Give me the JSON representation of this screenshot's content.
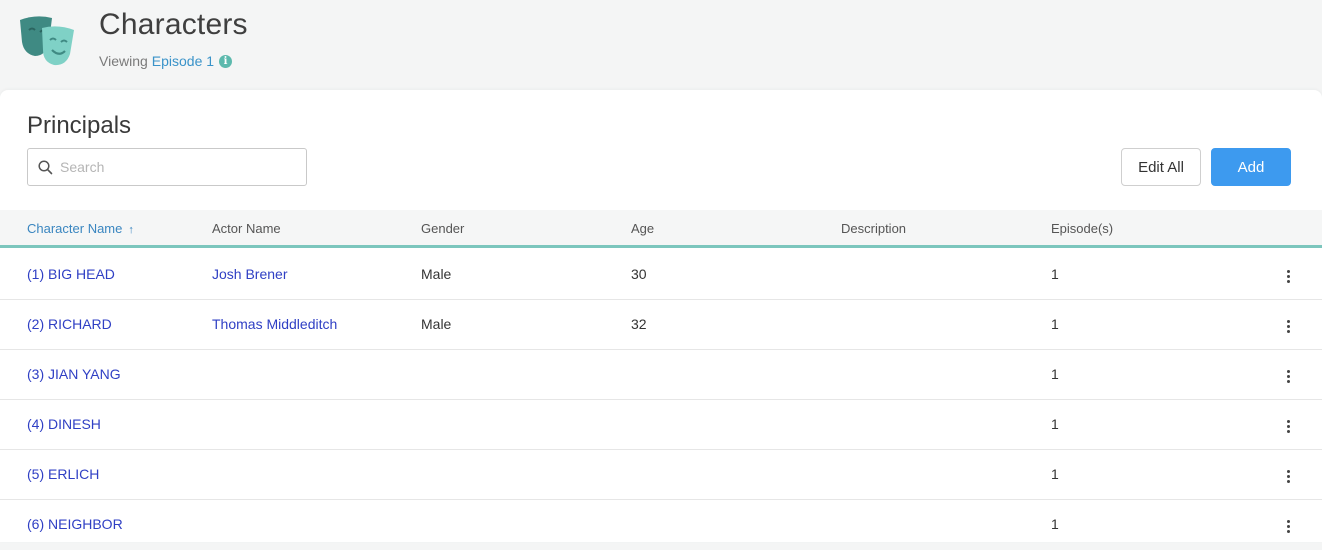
{
  "header": {
    "title": "Characters",
    "viewing_label": "Viewing",
    "episode_link": "Episode 1",
    "info_glyph": "i"
  },
  "section": {
    "title": "Principals",
    "search_placeholder": "Search",
    "edit_all_label": "Edit All",
    "add_label": "Add"
  },
  "table": {
    "columns": [
      "Character Name",
      "Actor Name",
      "Gender",
      "Age",
      "Description",
      "Episode(s)"
    ],
    "sort_indicator": "↑",
    "rows": [
      {
        "character": "(1) BIG HEAD",
        "actor": "Josh Brener",
        "gender": "Male",
        "age": "30",
        "description": "",
        "episodes": "1"
      },
      {
        "character": "(2) RICHARD",
        "actor": "Thomas Middleditch",
        "gender": "Male",
        "age": "32",
        "description": "",
        "episodes": "1"
      },
      {
        "character": "(3) JIAN YANG",
        "actor": "",
        "gender": "",
        "age": "",
        "description": "",
        "episodes": "1"
      },
      {
        "character": "(4) DINESH",
        "actor": "",
        "gender": "",
        "age": "",
        "description": "",
        "episodes": "1"
      },
      {
        "character": "(5) ERLICH",
        "actor": "",
        "gender": "",
        "age": "",
        "description": "",
        "episodes": "1"
      },
      {
        "character": "(6) NEIGHBOR",
        "actor": "",
        "gender": "",
        "age": "",
        "description": "",
        "episodes": "1"
      }
    ]
  },
  "colors": {
    "accent": "#3d9aef",
    "teal": "#5cb9ad",
    "link": "#2f3fc4",
    "header_link": "#3a93c9"
  }
}
